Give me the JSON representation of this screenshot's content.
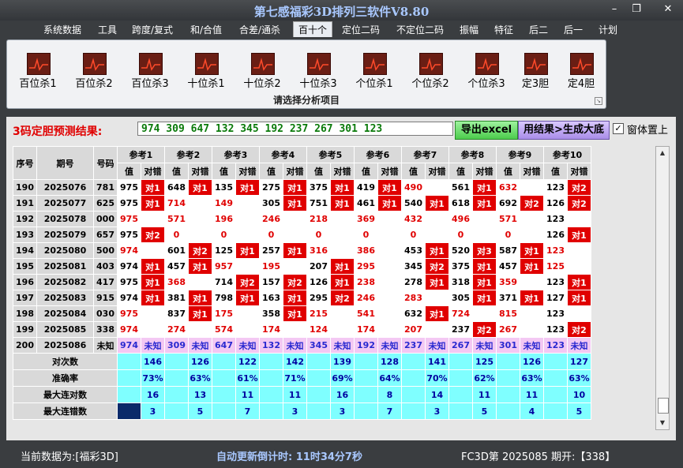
{
  "window": {
    "title": "第七感福彩3D排列三软件V8.80"
  },
  "menu": [
    "系统数据",
    "工具",
    "跨度/复式",
    "和/合值",
    "合差/通杀",
    "百十个",
    "定位二码",
    "不定位二码",
    "振幅",
    "特征",
    "后二",
    "后一",
    "计划"
  ],
  "ribbon": {
    "buttons": [
      "百位杀1",
      "百位杀2",
      "百位杀3",
      "十位杀1",
      "十位杀2",
      "十位杀3",
      "个位杀1",
      "个位杀2",
      "个位杀3",
      "定3胆",
      "定4胆"
    ],
    "caption": "请选择分析项目"
  },
  "result": {
    "label": "3码定胆预测结果:",
    "value": "974 309 647 132 345 192 237 267 301 123",
    "export_btn": "导出excel",
    "gen_btn": "用结果>生成大底",
    "on_top_label": "窗体置上"
  },
  "table": {
    "h_seq": "序号",
    "h_issue": "期号",
    "h_code": "号码",
    "refs": [
      "参考1",
      "参考2",
      "参考3",
      "参考4",
      "参考5",
      "参考6",
      "参考7",
      "参考8",
      "参考9",
      "参考10"
    ],
    "sub_val": "值",
    "sub_ok": "对错",
    "rows": [
      {
        "seq": "190",
        "issue": "2025076",
        "code": "781",
        "cells": [
          [
            "975",
            "对1"
          ],
          [
            "648",
            "对1"
          ],
          [
            "135",
            "对1"
          ],
          [
            "275",
            "对1"
          ],
          [
            "375",
            "对1"
          ],
          [
            "419",
            "对1"
          ],
          [
            "490",
            ""
          ],
          [
            "561",
            "对1"
          ],
          [
            "632",
            ""
          ],
          [
            "123",
            "对2"
          ]
        ]
      },
      {
        "seq": "191",
        "issue": "2025077",
        "code": "625",
        "cells": [
          [
            "975",
            "对1"
          ],
          [
            "714",
            ""
          ],
          [
            "149",
            ""
          ],
          [
            "305",
            "对1"
          ],
          [
            "751",
            "对1"
          ],
          [
            "461",
            "对1"
          ],
          [
            "540",
            "对1"
          ],
          [
            "618",
            "对1"
          ],
          [
            "692",
            "对2"
          ],
          [
            "126",
            "对2"
          ]
        ]
      },
      {
        "seq": "192",
        "issue": "2025078",
        "code": "000",
        "cells": [
          [
            "975",
            ""
          ],
          [
            "571",
            ""
          ],
          [
            "196",
            ""
          ],
          [
            "246",
            ""
          ],
          [
            "218",
            ""
          ],
          [
            "369",
            ""
          ],
          [
            "432",
            ""
          ],
          [
            "496",
            ""
          ],
          [
            "571",
            ""
          ],
          [
            "123",
            ""
          ]
        ]
      },
      {
        "seq": "193",
        "issue": "2025079",
        "code": "657",
        "cells": [
          [
            "975",
            "对2"
          ],
          [
            "0",
            ""
          ],
          [
            "0",
            ""
          ],
          [
            "0",
            ""
          ],
          [
            "0",
            ""
          ],
          [
            "0",
            ""
          ],
          [
            "0",
            ""
          ],
          [
            "0",
            ""
          ],
          [
            "0",
            ""
          ],
          [
            "126",
            "对1"
          ]
        ]
      },
      {
        "seq": "194",
        "issue": "2025080",
        "code": "500",
        "cells": [
          [
            "974",
            ""
          ],
          [
            "601",
            "对2"
          ],
          [
            "125",
            "对1"
          ],
          [
            "257",
            "对1"
          ],
          [
            "316",
            ""
          ],
          [
            "386",
            ""
          ],
          [
            "453",
            "对1"
          ],
          [
            "520",
            "对3"
          ],
          [
            "587",
            "对1"
          ],
          [
            "123",
            ""
          ]
        ]
      },
      {
        "seq": "195",
        "issue": "2025081",
        "code": "403",
        "cells": [
          [
            "974",
            "对1"
          ],
          [
            "457",
            "对1"
          ],
          [
            "957",
            ""
          ],
          [
            "195",
            ""
          ],
          [
            "207",
            "对1"
          ],
          [
            "295",
            ""
          ],
          [
            "345",
            "对2"
          ],
          [
            "375",
            "对1"
          ],
          [
            "457",
            "对1"
          ],
          [
            "125",
            ""
          ]
        ]
      },
      {
        "seq": "196",
        "issue": "2025082",
        "code": "417",
        "cells": [
          [
            "975",
            "对1"
          ],
          [
            "368",
            ""
          ],
          [
            "714",
            "对2"
          ],
          [
            "157",
            "对2"
          ],
          [
            "126",
            "对1"
          ],
          [
            "238",
            ""
          ],
          [
            "278",
            "对1"
          ],
          [
            "318",
            "对1"
          ],
          [
            "359",
            ""
          ],
          [
            "123",
            "对1"
          ]
        ]
      },
      {
        "seq": "197",
        "issue": "2025083",
        "code": "915",
        "cells": [
          [
            "974",
            "对1"
          ],
          [
            "381",
            "对1"
          ],
          [
            "798",
            "对1"
          ],
          [
            "163",
            "对1"
          ],
          [
            "295",
            "对2"
          ],
          [
            "246",
            ""
          ],
          [
            "283",
            ""
          ],
          [
            "305",
            "对1"
          ],
          [
            "371",
            "对1"
          ],
          [
            "127",
            "对1"
          ]
        ]
      },
      {
        "seq": "198",
        "issue": "2025084",
        "code": "030",
        "cells": [
          [
            "975",
            ""
          ],
          [
            "837",
            "对1"
          ],
          [
            "175",
            ""
          ],
          [
            "358",
            "对1"
          ],
          [
            "215",
            ""
          ],
          [
            "541",
            ""
          ],
          [
            "632",
            "对1"
          ],
          [
            "724",
            ""
          ],
          [
            "815",
            ""
          ],
          [
            "123",
            ""
          ]
        ]
      },
      {
        "seq": "199",
        "issue": "2025085",
        "code": "338",
        "cells": [
          [
            "974",
            ""
          ],
          [
            "274",
            ""
          ],
          [
            "574",
            ""
          ],
          [
            "174",
            ""
          ],
          [
            "124",
            ""
          ],
          [
            "174",
            ""
          ],
          [
            "207",
            ""
          ],
          [
            "237",
            "对2"
          ],
          [
            "267",
            ""
          ],
          [
            "123",
            "对2"
          ]
        ]
      }
    ],
    "last_row": {
      "seq": "200",
      "issue": "2025086",
      "code": "未知",
      "values": [
        "974",
        "309",
        "647",
        "132",
        "345",
        "192",
        "237",
        "267",
        "301",
        "123"
      ],
      "unknown": "未知"
    },
    "stats": [
      {
        "label": "对次数",
        "values": [
          "146",
          "126",
          "122",
          "142",
          "139",
          "128",
          "141",
          "125",
          "126",
          "127"
        ]
      },
      {
        "label": "准确率",
        "values": [
          "73%",
          "63%",
          "61%",
          "71%",
          "69%",
          "64%",
          "70%",
          "62%",
          "63%",
          "63%"
        ]
      },
      {
        "label": "最大连对数",
        "values": [
          "16",
          "13",
          "11",
          "11",
          "16",
          "8",
          "14",
          "11",
          "11",
          "10"
        ]
      },
      {
        "label": "最大连错数",
        "values": [
          "3",
          "5",
          "7",
          "3",
          "3",
          "7",
          "3",
          "5",
          "4",
          "5"
        ]
      }
    ]
  },
  "miss_rows": {
    "190": [
      false,
      false,
      false,
      false,
      false,
      false,
      true,
      false,
      true,
      false
    ],
    "191": [
      false,
      true,
      true,
      false,
      false,
      false,
      false,
      false,
      false,
      false
    ],
    "192": [
      true,
      true,
      true,
      true,
      true,
      true,
      true,
      true,
      true,
      false
    ],
    "193": [
      false,
      true,
      true,
      true,
      true,
      true,
      true,
      true,
      true,
      false
    ],
    "194": [
      true,
      false,
      false,
      false,
      true,
      true,
      false,
      false,
      false,
      true
    ],
    "195": [
      false,
      false,
      true,
      true,
      false,
      true,
      false,
      false,
      false,
      true
    ],
    "196": [
      false,
      true,
      false,
      false,
      false,
      true,
      false,
      false,
      true,
      false
    ],
    "197": [
      false,
      false,
      false,
      false,
      false,
      true,
      true,
      false,
      false,
      false
    ],
    "198": [
      true,
      false,
      true,
      false,
      true,
      true,
      false,
      true,
      true,
      false
    ],
    "199": [
      true,
      true,
      true,
      true,
      true,
      true,
      true,
      false,
      true,
      false
    ]
  },
  "status": {
    "current": "当前数据为:[福彩3D]",
    "countdown": "自动更新倒计时: 11时34分7秒",
    "draw": "FC3D第 2025085 期开:【338】"
  },
  "colors": {
    "hit": "#e00000",
    "stats_bg": "#7fffff",
    "last_row_bg": "#f3c8f3"
  }
}
